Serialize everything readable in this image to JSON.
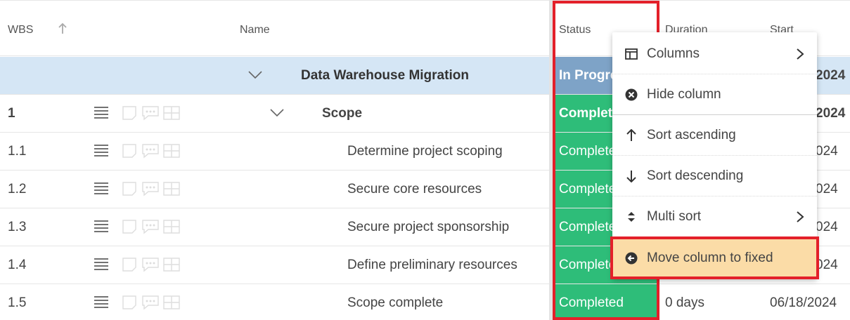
{
  "header": {
    "wbs": "WBS",
    "name": "Name",
    "status": "Status",
    "duration": "Duration",
    "start": "Start"
  },
  "rows": [
    {
      "wbs": "",
      "name": "Data Warehouse Migration",
      "status": "In Progress",
      "duration": "",
      "start": "2024",
      "type": "group"
    },
    {
      "wbs": "1",
      "name": "Scope",
      "status": "Completed",
      "duration": "",
      "start": "2024",
      "type": "summary"
    },
    {
      "wbs": "1.1",
      "name": "Determine project scoping",
      "status": "Completed",
      "duration": "",
      "start": "024",
      "type": "task"
    },
    {
      "wbs": "1.2",
      "name": "Secure core resources",
      "status": "Completed",
      "duration": "",
      "start": "024",
      "type": "task"
    },
    {
      "wbs": "1.3",
      "name": "Secure project sponsorship",
      "status": "Completed",
      "duration": "",
      "start": "024",
      "type": "task"
    },
    {
      "wbs": "1.4",
      "name": "Define preliminary resources",
      "status": "Completed",
      "duration": "",
      "start": "024",
      "type": "task"
    },
    {
      "wbs": "1.5",
      "name": "Scope complete",
      "status": "Completed",
      "duration": "0 days",
      "start": "06/18/2024",
      "type": "task"
    }
  ],
  "context_menu": {
    "items": [
      {
        "label": "Columns",
        "icon": "columns-icon",
        "submenu": true
      },
      {
        "label": "Hide column",
        "icon": "hide-column-icon",
        "submenu": false
      },
      {
        "label": "Sort ascending",
        "icon": "arrow-up-icon",
        "submenu": false
      },
      {
        "label": "Sort descending",
        "icon": "arrow-down-icon",
        "submenu": false
      },
      {
        "label": "Multi sort",
        "icon": "multi-sort-icon",
        "submenu": true
      },
      {
        "label": "Move column to fixed",
        "icon": "move-left-icon",
        "submenu": false,
        "active": true
      }
    ]
  },
  "colors": {
    "completed": "#2ebd79",
    "in_progress": "#7ea3c7",
    "group_row": "#d5e6f5",
    "highlight": "#e3202a",
    "active_item": "#fbdca7"
  }
}
